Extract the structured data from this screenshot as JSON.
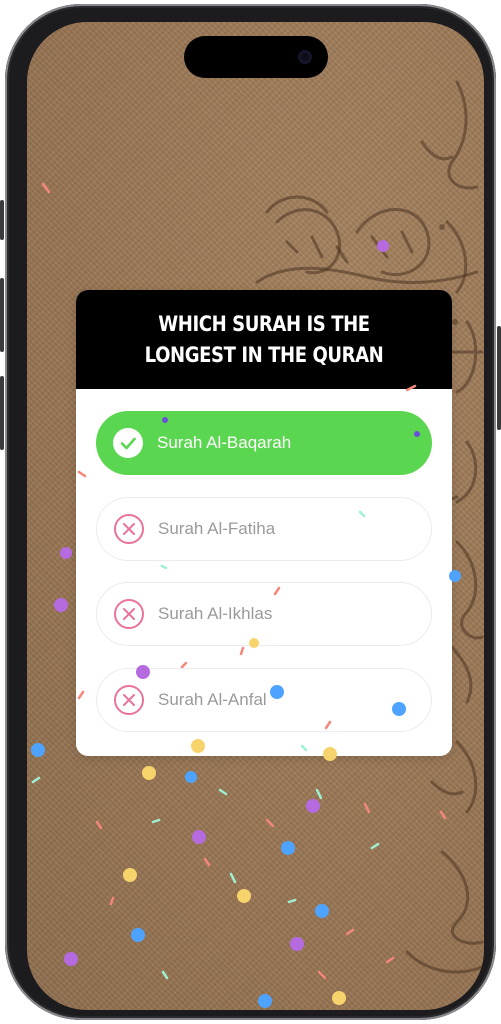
{
  "quiz": {
    "question": "WHICH SURAH IS THE LONGEST IN THE QURAN",
    "options": [
      {
        "label": "Surah Al-Baqarah",
        "state": "correct",
        "icon": "check-icon"
      },
      {
        "label": "Surah Al-Fatiha",
        "state": "wrong",
        "icon": "cross-icon"
      },
      {
        "label": "Surah Al-Ikhlas",
        "state": "wrong",
        "icon": "cross-icon"
      },
      {
        "label": "Surah Al-Anfal",
        "state": "wrong",
        "icon": "cross-icon"
      }
    ]
  },
  "colors": {
    "correct": "#5bd650",
    "wrong_icon": "#e9739a",
    "header": "#000000",
    "background": "#9c7a58"
  }
}
